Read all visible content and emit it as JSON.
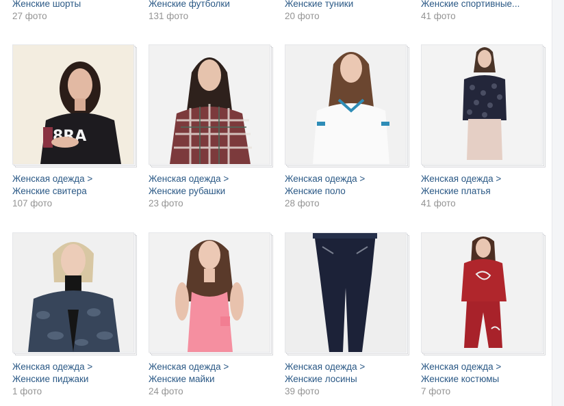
{
  "top_row": [
    {
      "name": "Женские шорты",
      "count": "27 фото"
    },
    {
      "name": "Женские футболки",
      "count": "131 фото"
    },
    {
      "name": "Женские туники",
      "count": "20 фото"
    },
    {
      "name": "Женские спортивные...",
      "count": "41 фото"
    }
  ],
  "albums": [
    {
      "parent": "Женская одежда >",
      "name": "Женские свитера",
      "count": "107 фото"
    },
    {
      "parent": "Женская одежда >",
      "name": "Женские рубашки",
      "count": "23 фото"
    },
    {
      "parent": "Женская одежда >",
      "name": "Женские поло",
      "count": "28 фото"
    },
    {
      "parent": "Женская одежда >",
      "name": "Женские платья",
      "count": "41 фото"
    },
    {
      "parent": "Женская одежда >",
      "name": "Женские пиджаки",
      "count": "1 фото"
    },
    {
      "parent": "Женская одежда >",
      "name": "Женские майки",
      "count": "24 фото"
    },
    {
      "parent": "Женская одежда >",
      "name": "Женские лосины",
      "count": "39 фото"
    },
    {
      "parent": "Женская одежда >",
      "name": "Женские костюмы",
      "count": "7 фото"
    }
  ],
  "colors": {
    "link": "#2a5885",
    "muted": "#939393"
  }
}
